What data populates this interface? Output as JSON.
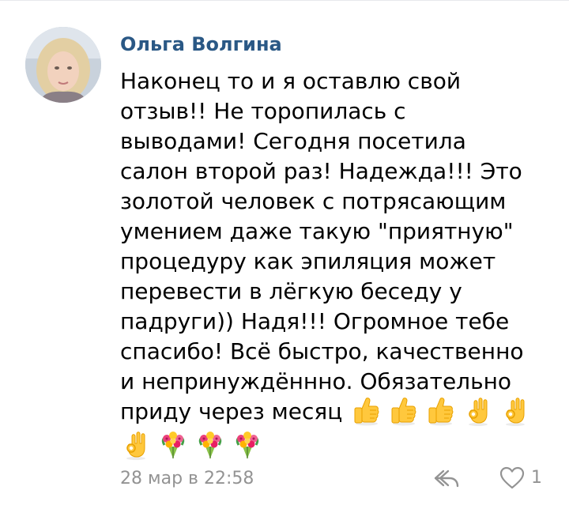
{
  "comment": {
    "author": "Ольга Волгина",
    "text_lines": [
      "Наконец то и я оставлю свой",
      "отзыв!! Не торопилась с",
      "выводами! Сегодня посетила",
      "салон второй раз! Надежда!!! Это",
      "золотой человек с потрясающим",
      "умением даже такую \"приятную\"",
      "процедуру как эпиляция может",
      "перевести в лёгкую беседу у",
      "падруги)) Надя!!! Огромное тебе",
      "спасибо! Всё быстро, качественно",
      "и непринуждённно. Обязательно",
      "приду через месяц"
    ],
    "emojis": [
      "thumbs-up",
      "thumbs-up",
      "thumbs-up",
      "ok-hand",
      "ok-hand",
      "ok-hand",
      "bouquet",
      "bouquet",
      "bouquet"
    ],
    "timestamp": "28 мар в 22:58",
    "like_count": "1"
  },
  "icons": {
    "reply": "reply-arrow-icon",
    "like": "heart-icon"
  },
  "colors": {
    "author_link": "#2a5885",
    "meta_text": "#939393",
    "body_text": "#000000",
    "divider": "#e7e8ec"
  }
}
